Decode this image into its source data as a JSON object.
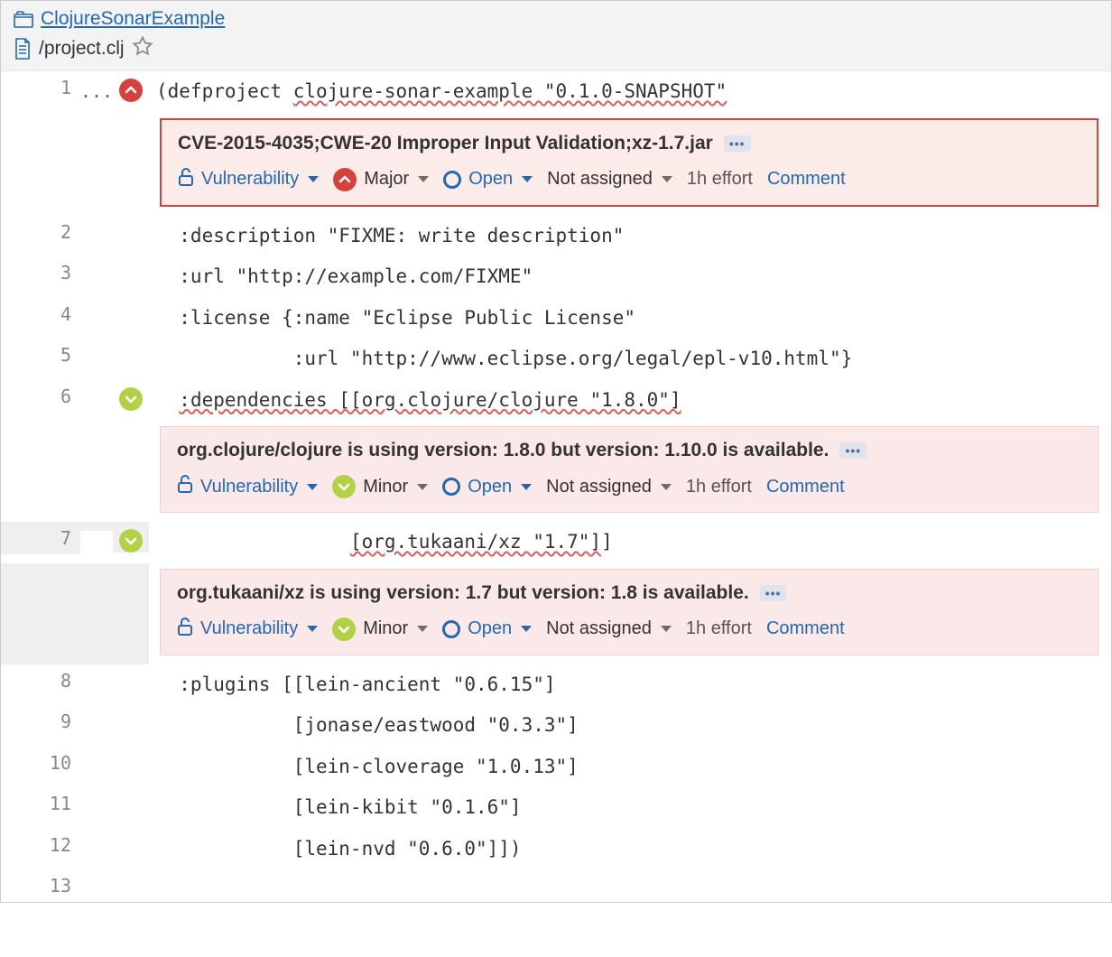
{
  "header": {
    "project_name": "ClojureSonarExample",
    "file_path": "/project.clj"
  },
  "lines": [
    {
      "num": 1,
      "fold": "...",
      "severity": "major",
      "code_prefix": "(defproject ",
      "code_squiggle": "clojure-sonar-example \"0.1.0-SNAPSHOT\"",
      "shaded": false
    },
    {
      "num": 2,
      "code_plain": "  :description \"FIXME: write description\""
    },
    {
      "num": 3,
      "code_plain": "  :url \"http://example.com/FIXME\""
    },
    {
      "num": 4,
      "code_plain": "  :license {:name \"Eclipse Public License\""
    },
    {
      "num": 5,
      "code_plain": "            :url \"http://www.eclipse.org/legal/epl-v10.html\"}"
    },
    {
      "num": 6,
      "severity": "minor",
      "code_prefix": "  ",
      "code_squiggle": ":dependencies [[org.clojure/clojure \"1.8.0\"]"
    },
    {
      "num": 7,
      "severity": "minor",
      "shaded": true,
      "code_prefix": "                 ",
      "code_squiggle": "[org.tukaani/xz \"1.7\"]",
      "code_suffix": "]"
    },
    {
      "num": 8,
      "code_plain": "  :plugins [[lein-ancient \"0.6.15\"]"
    },
    {
      "num": 9,
      "code_plain": "            [jonase/eastwood \"0.3.3\"]"
    },
    {
      "num": 10,
      "code_plain": "            [lein-cloverage \"1.0.13\"]"
    },
    {
      "num": 11,
      "code_plain": "            [lein-kibit \"0.1.6\"]"
    },
    {
      "num": 12,
      "code_plain": "            [lein-nvd \"0.6.0\"]])"
    },
    {
      "num": 13,
      "code_plain": ""
    }
  ],
  "issues": {
    "after_line_1": {
      "selected": true,
      "title": "CVE-2015-4035;CWE-20 Improper Input Validation;xz-1.7.jar",
      "type": "Vulnerability",
      "severity_label": "Major",
      "severity": "major",
      "status": "Open",
      "assignee": "Not assigned",
      "effort": "1h effort",
      "comment_label": "Comment"
    },
    "after_line_6": {
      "selected": false,
      "title": "org.clojure/clojure is using version: 1.8.0 but version: 1.10.0 is available.",
      "type": "Vulnerability",
      "severity_label": "Minor",
      "severity": "minor",
      "status": "Open",
      "assignee": "Not assigned",
      "effort": "1h effort",
      "comment_label": "Comment"
    },
    "after_line_7": {
      "selected": false,
      "shaded": true,
      "title": "org.tukaani/xz is using version: 1.7 but version: 1.8 is available.",
      "type": "Vulnerability",
      "severity_label": "Minor",
      "severity": "minor",
      "status": "Open",
      "assignee": "Not assigned",
      "effort": "1h effort",
      "comment_label": "Comment"
    }
  }
}
